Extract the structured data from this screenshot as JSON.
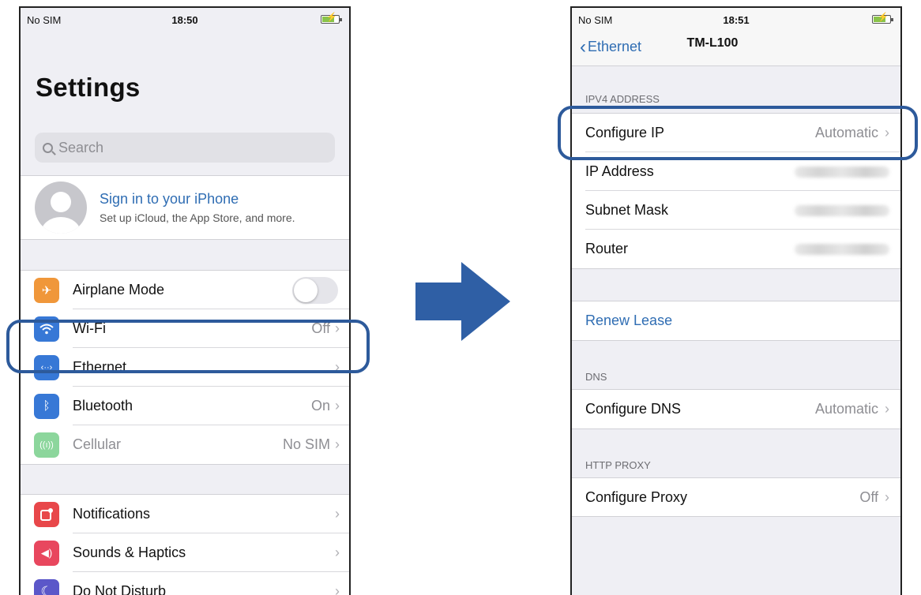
{
  "left_screen": {
    "status": {
      "carrier": "No SIM",
      "time": "18:50"
    },
    "title": "Settings",
    "search_placeholder": "Search",
    "profile": {
      "title": "Sign in to your iPhone",
      "subtitle": "Set up iCloud, the App Store, and more."
    },
    "group1": [
      {
        "label": "Airplane Mode",
        "value": "",
        "icon": "airplane-icon",
        "color": "#f0973a"
      },
      {
        "label": "Wi-Fi",
        "value": "Off",
        "icon": "wifi-icon",
        "color": "#3778d6"
      },
      {
        "label": "Ethernet",
        "value": "",
        "icon": "ethernet-icon",
        "color": "#3778d6"
      },
      {
        "label": "Bluetooth",
        "value": "On",
        "icon": "bluetooth-icon",
        "color": "#3778d6"
      },
      {
        "label": "Cellular",
        "value": "No SIM",
        "icon": "cellular-icon",
        "color": "#8cd69c"
      }
    ],
    "group2": [
      {
        "label": "Notifications",
        "icon": "notifications-icon",
        "color": "#e8474a"
      },
      {
        "label": "Sounds & Haptics",
        "icon": "sound-icon",
        "color": "#e8475e"
      },
      {
        "label": "Do Not Disturb",
        "icon": "moon-icon",
        "color": "#5b57c9"
      }
    ]
  },
  "right_screen": {
    "status": {
      "carrier": "No SIM",
      "time": "18:51"
    },
    "nav": {
      "back_label": "Ethernet",
      "title": "TM-L100"
    },
    "ipv4_header": "IPV4 ADDRESS",
    "ipv4_rows": [
      {
        "label": "Configure IP",
        "value": "Automatic"
      },
      {
        "label": "IP Address"
      },
      {
        "label": "Subnet Mask"
      },
      {
        "label": "Router"
      }
    ],
    "renew_lease": "Renew Lease",
    "dns_header": "DNS",
    "dns_row": {
      "label": "Configure DNS",
      "value": "Automatic"
    },
    "proxy_header": "HTTP PROXY",
    "proxy_row": {
      "label": "Configure Proxy",
      "value": "Off"
    }
  },
  "colors": {
    "highlight": "#2d5a9b",
    "link": "#2f6db3",
    "arrow": "#2f5fa5"
  }
}
